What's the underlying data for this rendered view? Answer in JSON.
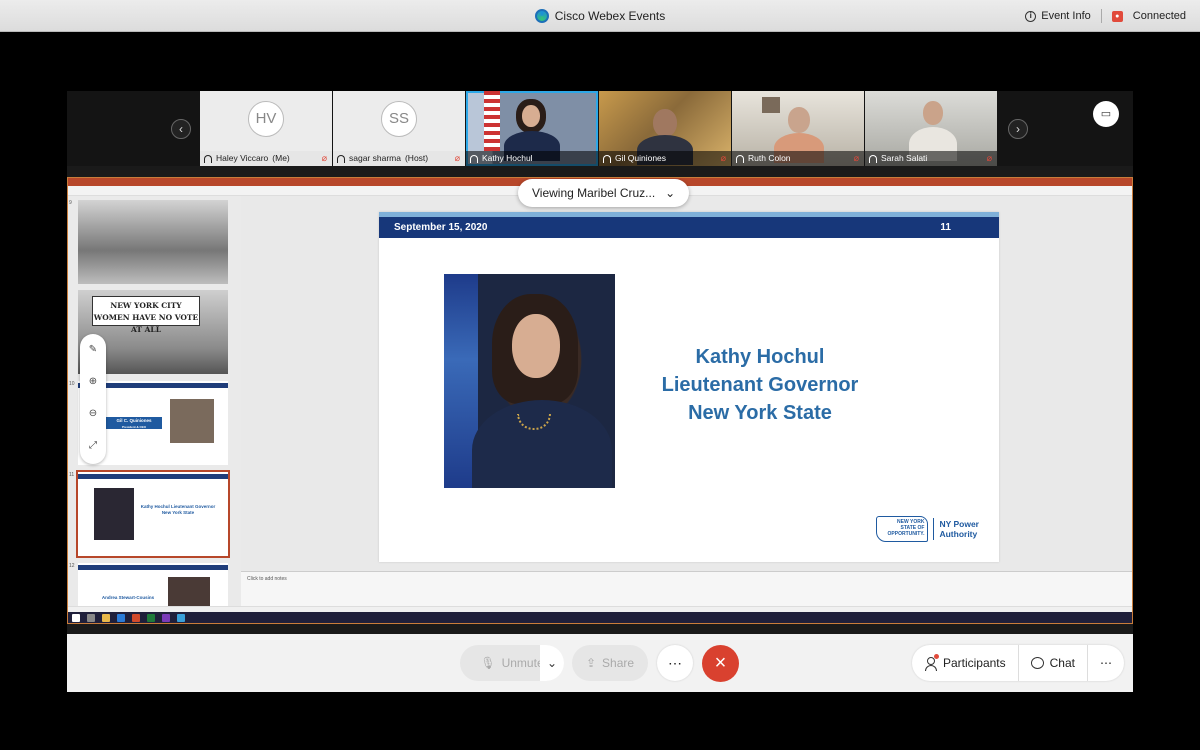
{
  "window": {
    "title": "Cisco Webex Events",
    "event_info": "Event Info",
    "status": "Connected",
    "status_icon": "record-icon"
  },
  "participants": [
    {
      "initials": "HV",
      "name": "Haley Viccaro",
      "role": "(Me)",
      "muted": true
    },
    {
      "initials": "SS",
      "name": "sagar sharma",
      "role": "(Host)",
      "muted": true
    },
    {
      "initials": "",
      "name": "Kathy Hochul",
      "role": "",
      "muted": false,
      "active": true
    },
    {
      "initials": "",
      "name": "Gil Quiniones",
      "role": "",
      "muted": true
    },
    {
      "initials": "",
      "name": "Ruth Colon",
      "role": "",
      "muted": true
    },
    {
      "initials": "",
      "name": "Sarah Salati",
      "role": "",
      "muted": true
    }
  ],
  "share": {
    "viewing_label": "Viewing Maribel Cruz...",
    "thumbnail_banner": "NEW YORK CITY WOMEN HAVE NO VOTE AT ALL",
    "thumbnail_gil_name": "Gil C. Quiniones",
    "thumbnail_gil_title": "President & CEO",
    "thumbnail_kathy": "Kathy Hochul Lieutenant Governor New York State",
    "thumbnail_andrea": "Andrea Stewart-Cousins",
    "slide_numbers": [
      "9",
      "10",
      "11",
      "12"
    ],
    "notes_placeholder": "Click to add notes"
  },
  "slide": {
    "date": "September 15, 2020",
    "number": "11",
    "name_line1": "Kathy Hochul",
    "name_line2": "Lieutenant Governor",
    "name_line3": "New York State",
    "logo_state": "NEW YORK STATE OF OPPORTUNITY.",
    "logo_line1": "NY Power",
    "logo_line2": "Authority"
  },
  "controls": {
    "unmute": "Unmute",
    "share": "Share",
    "more": "⋯",
    "participants": "Participants",
    "chat": "Chat"
  },
  "colors": {
    "active_border": "#2da8e8",
    "end_button": "#d9412f",
    "slide_header": "#17377a",
    "slide_name": "#2b6ca6"
  }
}
